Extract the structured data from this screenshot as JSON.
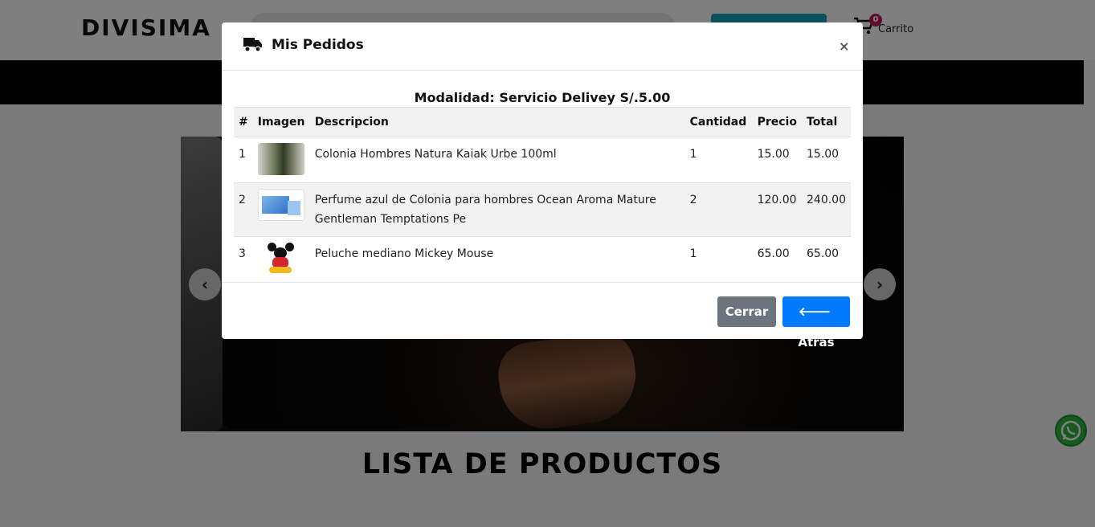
{
  "header": {
    "logo": "DIVISIMA",
    "cart_count": "0",
    "cart_label": "Carrito"
  },
  "main": {
    "section_title": "LISTA DE PRODUCTOS"
  },
  "modal": {
    "title": "Mis Pedidos",
    "close_symbol": "×",
    "modalidad": "Modalidad: Servicio Delivey S/.5.00",
    "columns": [
      "#",
      "Imagen",
      "Descripcion",
      "Cantidad",
      "Precio",
      "Total"
    ],
    "rows": [
      {
        "num": "1",
        "description": "Colonia Hombres Natura Kaiak Urbe 100ml",
        "quantity": "1",
        "price": "15.00",
        "total": "15.00"
      },
      {
        "num": "2",
        "description": "Perfume azul de Colonia para hombres Ocean Aroma Mature Gentleman Temptations Pe",
        "quantity": "2",
        "price": "120.00",
        "total": "240.00"
      },
      {
        "num": "3",
        "description": "Peluche mediano Mickey Mouse",
        "quantity": "1",
        "price": "65.00",
        "total": "65.00"
      }
    ],
    "close_button": "Cerrar",
    "back_button": "Atras"
  },
  "icons": {
    "header": "truck-icon",
    "cart": "cart-icon",
    "back": "arrow-left-icon",
    "carousel_prev": "chevron-left-icon",
    "carousel_next": "chevron-right-icon",
    "chat": "whatsapp-icon"
  },
  "colors": {
    "brand_accent": "#c2185b",
    "primary_button": "#007bff",
    "secondary_button": "#6c757d",
    "whatsapp": "#2fb342"
  }
}
